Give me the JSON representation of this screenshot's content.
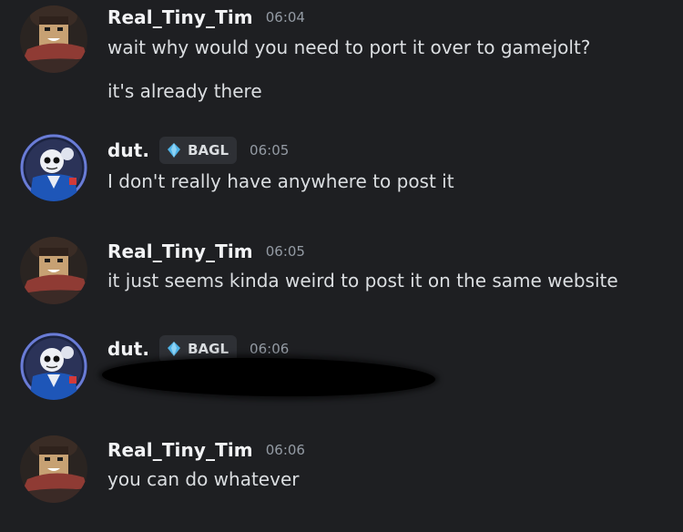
{
  "messages": [
    {
      "username": "Real_Tiny_Tim",
      "time": "06:04",
      "lines": [
        "wait why would you need to port it over to gamejolt?",
        "it's already there"
      ]
    },
    {
      "username": "dut.",
      "tag": "BAGL",
      "time": "06:05",
      "lines": [
        "I don't really have anywhere to post it"
      ]
    },
    {
      "username": "Real_Tiny_Tim",
      "time": "06:05",
      "lines": [
        "it just seems kinda weird to post it on the same website"
      ]
    },
    {
      "username": "dut.",
      "tag": "BAGL",
      "time": "06:06",
      "redacted": true
    },
    {
      "username": "Real_Tiny_Tim",
      "time": "06:06",
      "lines": [
        "you can do whatever"
      ]
    }
  ],
  "colors": {
    "background": "#1e1f22",
    "username": "#f2f3f5",
    "text": "#dbdee1",
    "timestamp": "#949ba4",
    "tag_bg": "#2e3035",
    "tag_icon": "#4fb3e8"
  },
  "icons": {
    "avatar_tim": "roblox-character-avatar",
    "avatar_dut": "skeleton-character-avatar",
    "tag_icon": "diamond-gem-icon"
  }
}
